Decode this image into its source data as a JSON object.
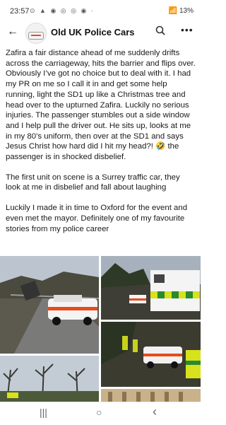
{
  "status_bar": {
    "time": "23:57",
    "battery": "13%"
  },
  "header": {
    "group_name": "Old UK Police Cars"
  },
  "post": {
    "paragraphs": [
      "Zafira a fair distance ahead of me suddenly drifts across the carriageway, hits the barrier and flips over. Obviously I’ve got no choice but to deal with it. I had my PR on me so I call it in and get some help running, light the SD1 up like a Christmas tree and head over to the upturned Zafira. Luckily no serious injuries. The passenger stumbles out a side window and I help pull the driver out. He sits up, looks at me in my 80’s uniform, then over at the SD1 and says Jesus Christ how hard did I hit my head?! 🤣 the passenger is in shocked disbelief.",
      "The first unit on scene is a Surrey traffic car, they look at me in disbelief and fall about laughing",
      "Luckily I made it in time to Oxford for the event and even met the mayor. Definitely one of my favourite stories from my police career"
    ]
  },
  "photos": [
    {
      "desc": "overturned car on road with SD1 police car"
    },
    {
      "desc": "ambulance and police car on road"
    },
    {
      "desc": "police officers at roadside scene"
    },
    {
      "desc": "trees and bare branches at dusk"
    },
    {
      "desc": "building facade"
    }
  ],
  "nav": {
    "recent": "|||",
    "home": "○",
    "back": "‹"
  },
  "colors": {
    "accent": "#1877f2",
    "police_orange": "#e74b1a",
    "ambulance_yellow": "#d7e21b"
  }
}
